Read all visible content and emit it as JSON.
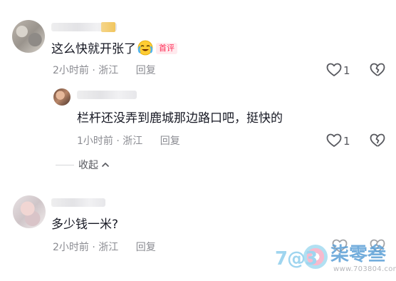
{
  "comments": [
    {
      "text": "这么快就开张了",
      "emoji": "crying-laughing-emoji",
      "badge": "首评",
      "time": "2小时前",
      "location": "浙江",
      "reply_label": "回复",
      "likes": "1",
      "replies": [
        {
          "text": "栏杆还没弄到鹿城那边路口吧，挺快的",
          "time": "1小时前",
          "location": "浙江",
          "reply_label": "回复",
          "likes": "1"
        }
      ],
      "collapse_label": "收起"
    },
    {
      "text": "多少钱一米?",
      "time": "2小时前",
      "location": "浙江",
      "reply_label": "回复"
    }
  ],
  "watermark": {
    "logo": "7@3",
    "title": "柒零叁",
    "url": "www.703804.com"
  },
  "colors": {
    "badge": "#fe2c55",
    "text": "#161823",
    "meta": "#8a8b91"
  }
}
